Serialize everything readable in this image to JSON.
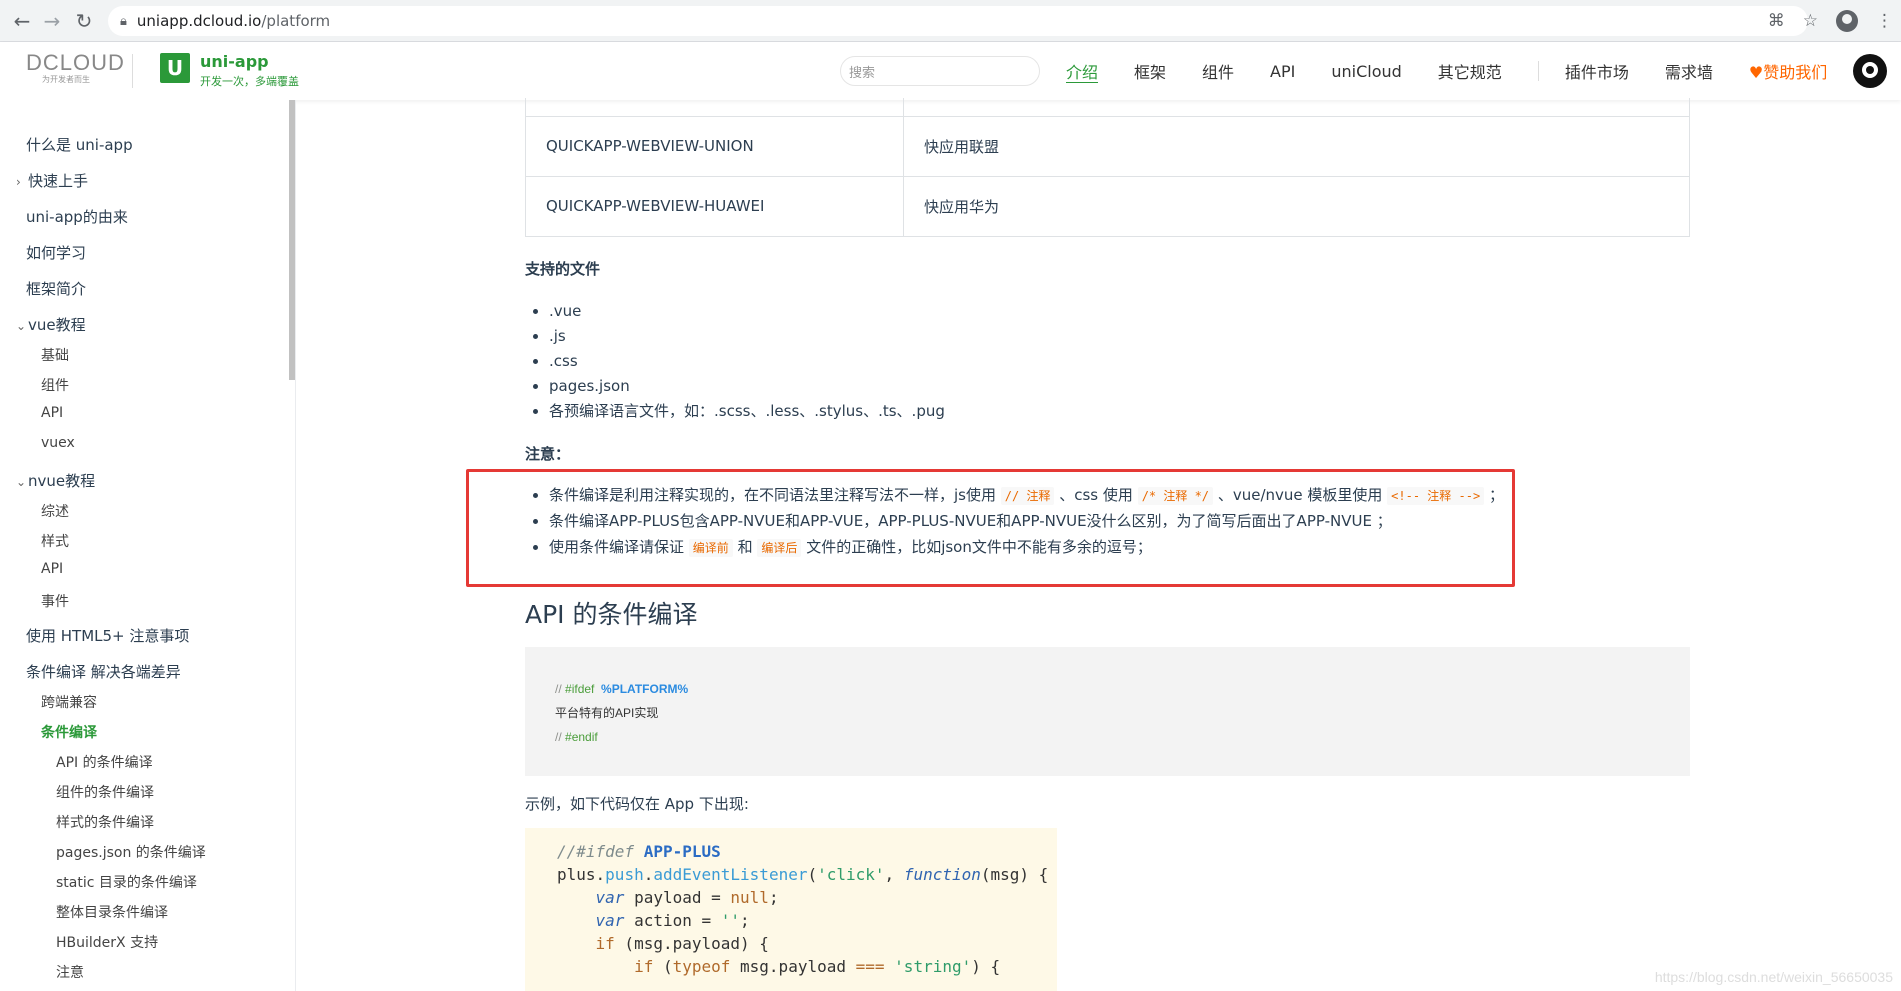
{
  "browser": {
    "url_host": "uniapp.dcloud.io",
    "url_path": "/platform"
  },
  "header": {
    "dcloud_logo": "DCLOUD",
    "dcloud_tagline": "为开发者而生",
    "uni_logo_letter": "U",
    "uni_name": "uni-app",
    "uni_slogan": "开发一次，多端覆盖",
    "search_placeholder": "搜索",
    "nav": [
      "介绍",
      "框架",
      "组件",
      "API",
      "uniCloud",
      "其它规范",
      "插件市场",
      "需求墙",
      "♥赞助我们"
    ]
  },
  "sidebar": {
    "items": [
      {
        "label": "什么是 uni-app"
      },
      {
        "label": "快速上手"
      },
      {
        "label": "uni-app的由来"
      },
      {
        "label": "如何学习"
      },
      {
        "label": "框架简介"
      },
      {
        "label": "vue教程"
      },
      {
        "label": "基础"
      },
      {
        "label": "组件"
      },
      {
        "label": "API"
      },
      {
        "label": "vuex"
      },
      {
        "label": "nvue教程"
      },
      {
        "label": "综述"
      },
      {
        "label": "样式"
      },
      {
        "label": "API"
      },
      {
        "label": "事件"
      },
      {
        "label": "使用 HTML5+ 注意事项"
      },
      {
        "label": "条件编译 解决各端差异"
      },
      {
        "label": "跨端兼容"
      },
      {
        "label": "条件编译"
      },
      {
        "label": "API 的条件编译"
      },
      {
        "label": "组件的条件编译"
      },
      {
        "label": "样式的条件编译"
      },
      {
        "label": "pages.json 的条件编译"
      },
      {
        "label": "static 目录的条件编译"
      },
      {
        "label": "整体目录条件编译"
      },
      {
        "label": "HBuilderX 支持"
      },
      {
        "label": "注意"
      }
    ]
  },
  "content": {
    "table_rows": [
      [
        "QUICKAPP-WEBVIEW-UNION",
        "快应用联盟"
      ],
      [
        "QUICKAPP-WEBVIEW-HUAWEI",
        "快应用华为"
      ]
    ],
    "files_heading": "支持的文件",
    "files": [
      ".vue",
      ".js",
      ".css",
      "pages.json",
      "各预编译语言文件，如：.scss、.less、.stylus、.ts、.pug"
    ],
    "note_heading": "注意：",
    "notes": {
      "n1_a": "条件编译是利用注释实现的，在不同语法里注释写法不一样，js使用",
      "n1_code1": "// 注释",
      "n1_b": "、css 使用",
      "n1_code2": "/* 注释 */",
      "n1_c": "、vue/nvue 模板里使用",
      "n1_code3": "<!-- 注释 -->",
      "n1_d": "；",
      "n2": "条件编译APP-PLUS包含APP-NVUE和APP-VUE，APP-PLUS-NVUE和APP-NVUE没什么区别，为了简写后面出了APP-NVUE ；",
      "n3_a": "使用条件编译请保证",
      "n3_code1": "编译前",
      "n3_b": "和",
      "n3_code2": "编译后",
      "n3_c": "文件的正确性，比如json文件中不能有多余的逗号；"
    },
    "api_heading": "API 的条件编译",
    "code1": {
      "l1_cm": "// ",
      "l1_kw": "#ifdef",
      "l1_macro": "%PLATFORM%",
      "l2": "平台特有的API实现",
      "l3_cm": "// ",
      "l3_kw": "#endif"
    },
    "example_text": "示例，如下代码仅在 App 下出现:",
    "code2": {
      "l1_cm": "//#ifdef ",
      "l1_bold": "APP-PLUS",
      "l2_a": "plus.",
      "l2_fn1": "push",
      "l2_b": ".",
      "l2_fn2": "addEventListener",
      "l2_c": "(",
      "l2_str": "'click'",
      "l2_d": ", ",
      "l2_it": "function",
      "l2_e": "(msg) {",
      "l3_it": "var",
      "l3_a": " payload = ",
      "l3_nul": "null",
      "l3_b": ";",
      "l4_it": "var",
      "l4_a": " action = ",
      "l4_str": "''",
      "l4_b": ";",
      "l5_kw": "if",
      "l5_a": " (msg.payload) {",
      "l6_kw": "if",
      "l6_a": " (",
      "l6_kw2": "typeof",
      "l6_b": " msg.payload ",
      "l6_op": "===",
      "l6_c": " ",
      "l6_str": "'string'",
      "l6_d": ") {"
    },
    "watermark": "https://blog.csdn.net/weixin_56650035"
  }
}
